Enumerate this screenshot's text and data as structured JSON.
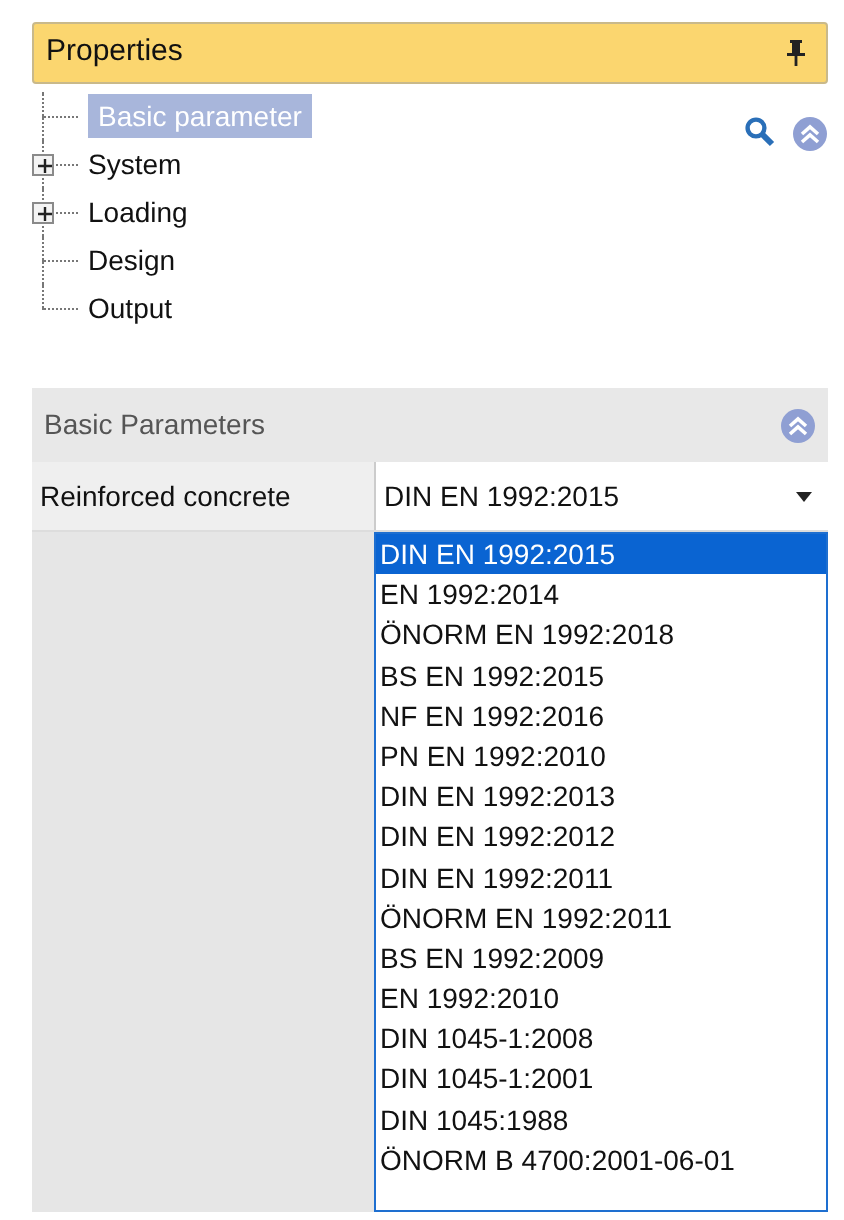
{
  "panel": {
    "title": "Properties"
  },
  "tree": [
    {
      "label": "Basic parameter",
      "selected": true
    },
    {
      "label": "System",
      "selected": false,
      "expanded": false
    },
    {
      "label": "Loading",
      "selected": false,
      "expanded": false
    },
    {
      "label": "Design",
      "selected": false
    },
    {
      "label": "Output",
      "selected": false
    }
  ],
  "section": {
    "title": "Basic Parameters"
  },
  "property": {
    "label": "Reinforced concrete",
    "value": "DIN EN 1992:2015",
    "expanded": true
  },
  "options": [
    {
      "label": "DIN EN 1992:2015",
      "selected": true
    },
    {
      "label": "EN 1992:2014",
      "selected": false
    },
    {
      "label": "ÖNORM EN 1992:2018",
      "selected": false
    },
    {
      "label": "BS EN 1992:2015",
      "selected": false
    },
    {
      "label": "NF EN 1992:2016",
      "selected": false
    },
    {
      "label": "PN EN 1992:2010",
      "selected": false
    },
    {
      "label": "DIN EN 1992:2013",
      "selected": false
    },
    {
      "label": "DIN EN 1992:2012",
      "selected": false
    },
    {
      "label": "DIN EN 1992:2011",
      "selected": false
    },
    {
      "label": "ÖNORM EN 1992:2011",
      "selected": false
    },
    {
      "label": "BS EN 1992:2009",
      "selected": false
    },
    {
      "label": "EN 1992:2010",
      "selected": false
    },
    {
      "label": "DIN 1045-1:2008",
      "selected": false
    },
    {
      "label": "DIN 1045-1:2001",
      "selected": false
    },
    {
      "label": "DIN 1045:1988",
      "selected": false
    },
    {
      "label": "ÖNORM B 4700:2001-06-01",
      "selected": false
    }
  ]
}
